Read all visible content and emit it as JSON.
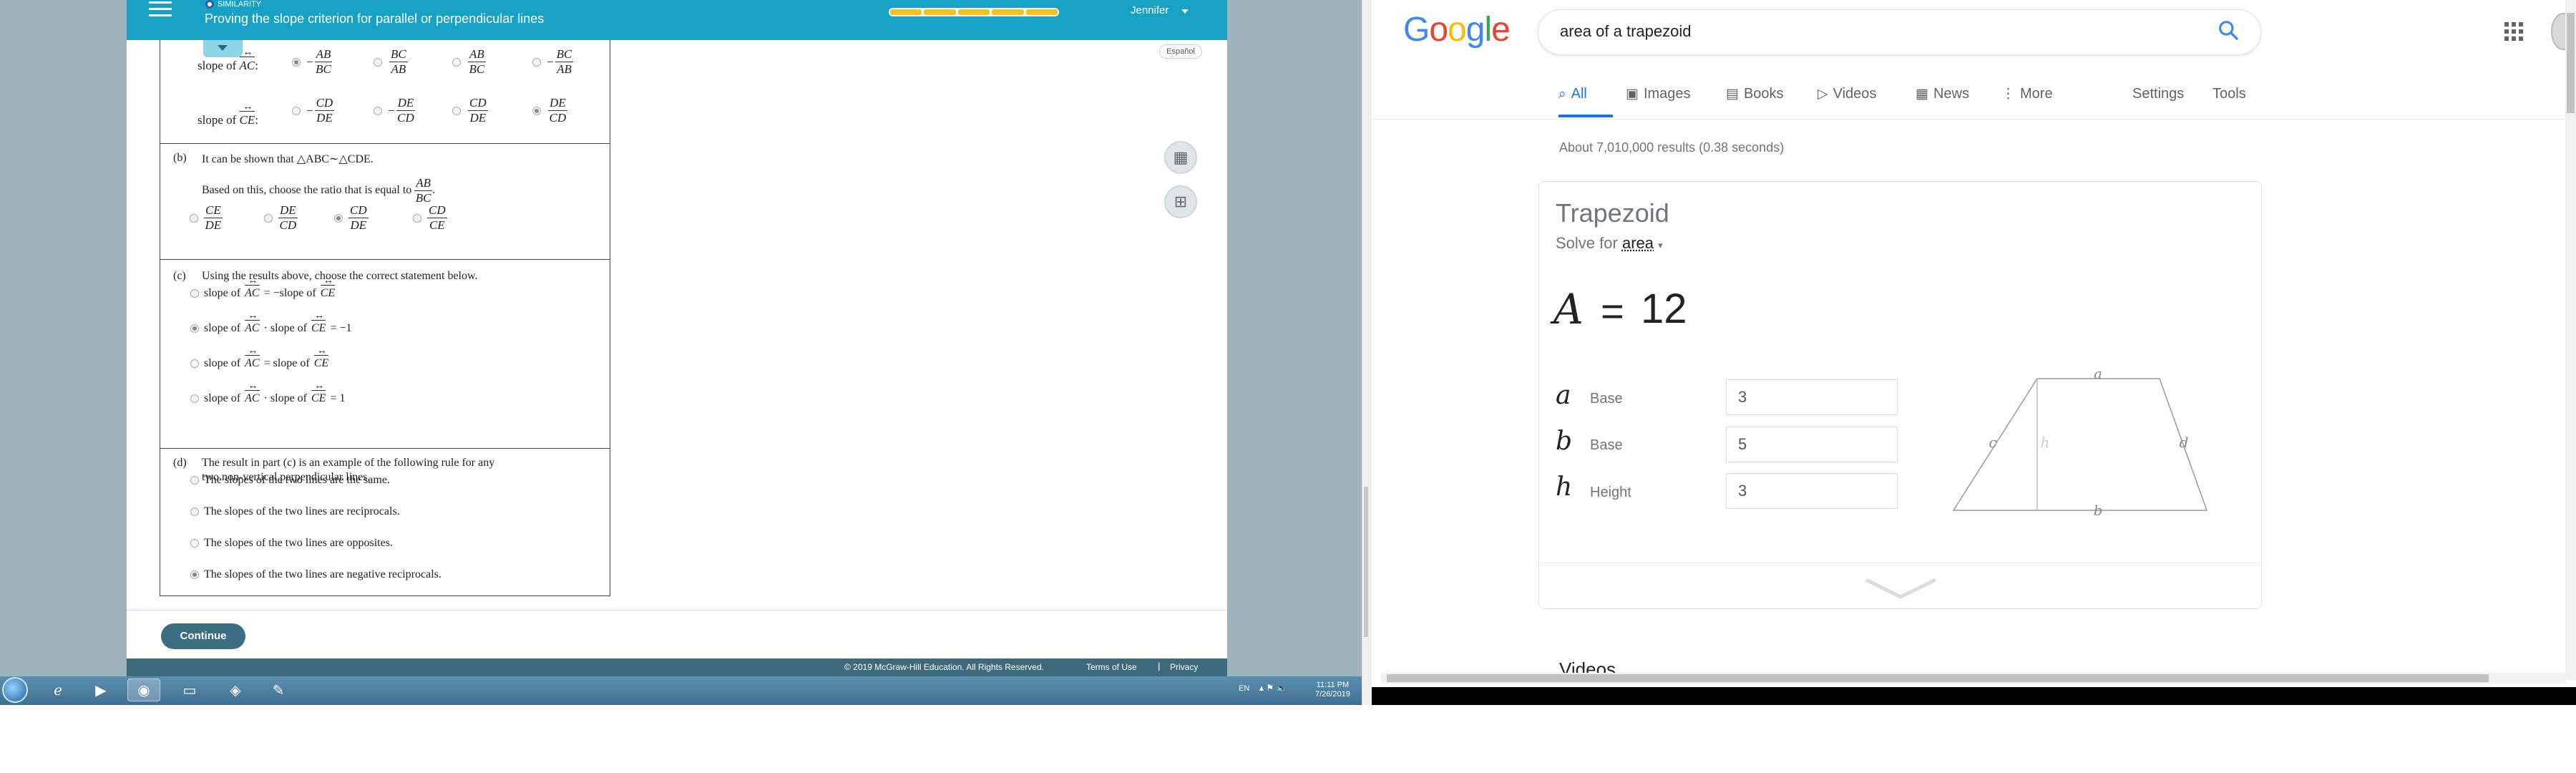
{
  "left_app": {
    "topic": "SIMILARITY",
    "lesson_title": "Proving the slope criterion for parallel or perpendicular lines",
    "user_name": "Jennifer",
    "espanol_label": "Español",
    "continue_label": "Continue",
    "footer_copyright": "© 2019 McGraw-Hill Education. All Rights Reserved.",
    "footer_terms": "Terms of Use",
    "footer_privacy": "Privacy",
    "footer_separator": "|",
    "calculator_icon": "calculator-icon",
    "reference_icon": "reference-icon",
    "part_a": {
      "row_ac_label": "slope of",
      "row_ac_var": "AC",
      "row_ac_colon": ":",
      "row_ac_options": [
        {
          "sign": "−",
          "num": "AB",
          "den": "BC",
          "selected": true
        },
        {
          "sign": "",
          "num": "BC",
          "den": "AB",
          "selected": false
        },
        {
          "sign": "",
          "num": "AB",
          "den": "BC",
          "selected": false
        },
        {
          "sign": "−",
          "num": "BC",
          "den": "AB",
          "selected": false
        }
      ],
      "row_ce_label": "slope of",
      "row_ce_var": "CE",
      "row_ce_colon": ":",
      "row_ce_options": [
        {
          "sign": "−",
          "num": "CD",
          "den": "DE",
          "selected": false
        },
        {
          "sign": "−",
          "num": "DE",
          "den": "CD",
          "selected": false
        },
        {
          "sign": "",
          "num": "CD",
          "den": "DE",
          "selected": false
        },
        {
          "sign": "",
          "num": "DE",
          "den": "CD",
          "selected": true
        }
      ]
    },
    "part_b": {
      "label": "(b)",
      "line1": "It can be shown that △ABC∼△CDE.",
      "line2": "Based on this, choose the ratio that is equal to",
      "ratio_num": "AB",
      "ratio_den": "BC",
      "ratio_end": ".",
      "options": [
        {
          "num": "CE",
          "den": "DE",
          "selected": false
        },
        {
          "num": "DE",
          "den": "CD",
          "selected": false
        },
        {
          "num": "CD",
          "den": "DE",
          "selected": true
        },
        {
          "num": "CD",
          "den": "CE",
          "selected": false
        }
      ]
    },
    "part_c": {
      "label": "(c)",
      "prompt": "Using the results above, choose the correct statement below.",
      "options": [
        {
          "a": "slope of",
          "v1": "AC",
          "mid": "= −slope of",
          "v2": "CE",
          "tail": "",
          "selected": false
        },
        {
          "a": "slope of",
          "v1": "AC",
          "mid": "· slope of",
          "v2": "CE",
          "tail": "= −1",
          "selected": true
        },
        {
          "a": "slope of",
          "v1": "AC",
          "mid": "= slope of",
          "v2": "CE",
          "tail": "",
          "selected": false
        },
        {
          "a": "slope of",
          "v1": "AC",
          "mid": "· slope of",
          "v2": "CE",
          "tail": "= 1",
          "selected": false
        }
      ]
    },
    "part_d": {
      "label": "(d)",
      "prompt_line1": "The result in part (c) is an example of the following rule for any",
      "prompt_line2": "two non-vertical perpendicular lines.",
      "options": [
        {
          "text": "The slopes of the two lines are the same.",
          "selected": false
        },
        {
          "text": "The slopes of the two lines are reciprocals.",
          "selected": false
        },
        {
          "text": "The slopes of the two lines are opposites.",
          "selected": false
        },
        {
          "text": "The slopes of the two lines are negative reciprocals.",
          "selected": true
        }
      ]
    }
  },
  "taskbar": {
    "language": "EN",
    "time": "11:11 PM",
    "date": "7/26/2019",
    "icons": [
      "windows-start-icon",
      "internet-explorer-icon",
      "media-player-icon",
      "firefox-icon",
      "file-explorer-icon",
      "app-icon",
      "paint-icon"
    ]
  },
  "google": {
    "logo": [
      "G",
      "o",
      "o",
      "g",
      "l",
      "e"
    ],
    "logo_colors": [
      "#4285F4",
      "#EA4335",
      "#FBBC05",
      "#4285F4",
      "#34A853",
      "#EA4335"
    ],
    "query": "area of a trapezoid",
    "tabs": [
      {
        "label": "All",
        "icon": "search-icon"
      },
      {
        "label": "Images",
        "icon": "image-icon"
      },
      {
        "label": "Books",
        "icon": "book-icon"
      },
      {
        "label": "Videos",
        "icon": "video-icon"
      },
      {
        "label": "News",
        "icon": "news-icon"
      },
      {
        "label": "More",
        "icon": "more-icon"
      }
    ],
    "settings_label": "Settings",
    "tools_label": "Tools",
    "results_count": "About 7,010,000 results (0.38 seconds)",
    "card": {
      "title": "Trapezoid",
      "solve_for_prefix": "Solve for",
      "solve_for_value": "area",
      "result_var": "A",
      "result_eq": "=",
      "result_value": "12",
      "inputs": [
        {
          "var": "a",
          "label": "Base",
          "value": "3"
        },
        {
          "var": "b",
          "label": "Base",
          "value": "5"
        },
        {
          "var": "h",
          "label": "Height",
          "value": "3"
        }
      ],
      "diagram_labels": {
        "a": "a",
        "b": "b",
        "c": "c",
        "d": "d",
        "h": "h"
      }
    },
    "next_heading": "Videos",
    "accent_color": "#1a73e8"
  }
}
